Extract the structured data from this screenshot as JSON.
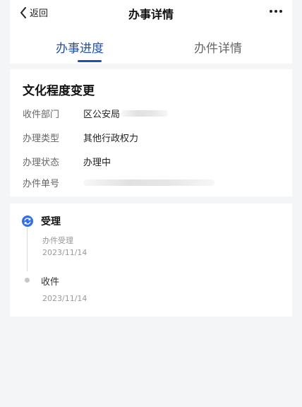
{
  "navbar": {
    "back_label": "返回",
    "title": "办事详情"
  },
  "tabs": [
    {
      "label": "办事进度",
      "active": true
    },
    {
      "label": "办件详情",
      "active": false
    }
  ],
  "colors": {
    "accent": "#1f4fb5",
    "timeline_active": "#2f6ef0",
    "timeline_inactive": "#c7c7c7"
  },
  "info": {
    "title": "文化程度变更",
    "rows": [
      {
        "label": "收件部门",
        "value": "区公安局"
      },
      {
        "label": "办理类型",
        "value": "其他行政权力"
      },
      {
        "label": "办理状态",
        "value": "办理中"
      },
      {
        "label": "办件单号",
        "value": ""
      }
    ]
  },
  "timeline": [
    {
      "title": "受理",
      "desc": "办件受理",
      "date": "2023/11/14",
      "state": "active",
      "icon": "refresh-icon"
    },
    {
      "title": "收件",
      "desc": "",
      "date": "2023/11/14",
      "state": "done",
      "icon": "dot-icon"
    }
  ]
}
